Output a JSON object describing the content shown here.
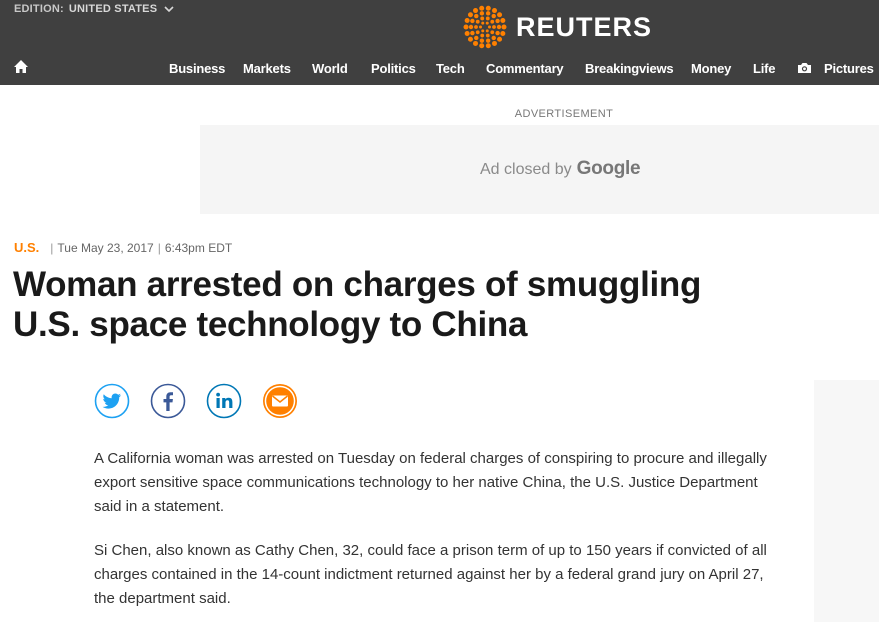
{
  "header": {
    "edition_label": "EDITION:",
    "edition_value": "UNITED STATES",
    "brand": "REUTERS",
    "brand_color": "#ff8000",
    "bg_color": "#404040"
  },
  "nav": {
    "home_icon": "home-icon",
    "items": [
      "Business",
      "Markets",
      "World",
      "Politics",
      "Tech",
      "Commentary",
      "Breakingviews",
      "Money",
      "Life",
      "Pictures"
    ],
    "pictures_icon": "camera-icon"
  },
  "ad": {
    "label": "ADVERTISEMENT",
    "closed_text": "Ad closed by",
    "closed_brand": "Google"
  },
  "article": {
    "section": "U.S.",
    "date": "Tue May 23, 2017",
    "time": "6:43pm EDT",
    "headline": "Woman arrested on charges of smuggling U.S. space technology to China",
    "share": [
      "twitter-icon",
      "facebook-icon",
      "linkedin-icon",
      "email-icon"
    ],
    "paragraphs": [
      "A California woman was arrested on Tuesday on federal charges of conspiring to procure and illegally export sensitive space communications technology to her native China, the U.S. Justice Department said in a statement.",
      "Si Chen, also known as Cathy Chen, 32, could face a prison term of up to 150 years if convicted of all charges contained in the 14-count indictment returned against her by a federal grand jury on April 27, the department said."
    ]
  }
}
